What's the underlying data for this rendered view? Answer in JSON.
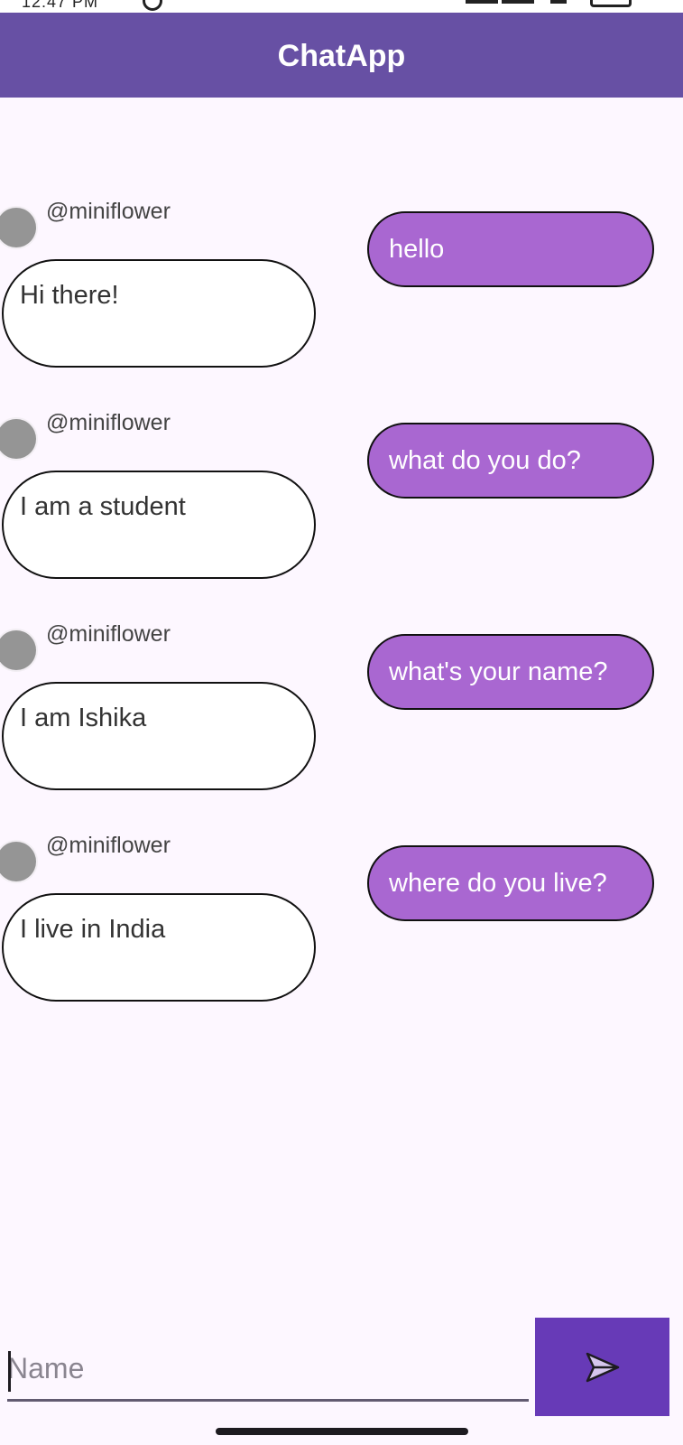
{
  "app": {
    "title": "ChatApp"
  },
  "messages": [
    {
      "username": "@miniflower",
      "incoming": "Hi there!",
      "outgoing": "hello"
    },
    {
      "username": "@miniflower",
      "incoming": "I am a student",
      "outgoing": "what do you do?"
    },
    {
      "username": "@miniflower",
      "incoming": "I am Ishika",
      "outgoing": "what's your name?"
    },
    {
      "username": "@miniflower",
      "incoming": "I live in India",
      "outgoing": "where do you live?"
    }
  ],
  "composer": {
    "value": "",
    "placeholder": "Name",
    "send_icon": "send-icon"
  },
  "colors": {
    "app_bar": "#6750a4",
    "background": "#fdf7ff",
    "outgoing_bubble": "#a967d1",
    "incoming_bubble": "#ffffff",
    "send_button": "#673ab7",
    "avatar": "#959595"
  }
}
